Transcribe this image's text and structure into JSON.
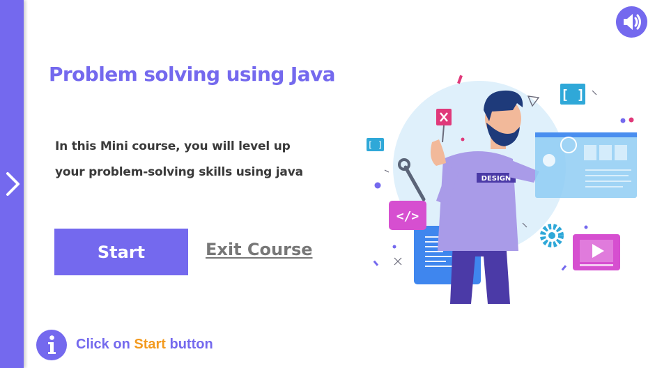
{
  "sidebar": {
    "next_icon": "chevron-right-icon"
  },
  "audio": {
    "icon": "speaker-icon"
  },
  "course": {
    "title": "Problem solving using Java",
    "description_line1": "In this Mini course, you will level up",
    "description_line2": "your problem-solving skills using java"
  },
  "actions": {
    "start_label": "Start",
    "exit_label": "Exit Course"
  },
  "hint": {
    "icon": "info-icon",
    "prefix": "Click on",
    "highlight": "Start",
    "suffix": "button"
  },
  "illustration": {
    "shirt_text": "DESIGN"
  },
  "colors": {
    "primary": "#7469ee",
    "accent": "#f39a1e",
    "text": "#3a3a3a",
    "muted": "#777777"
  }
}
